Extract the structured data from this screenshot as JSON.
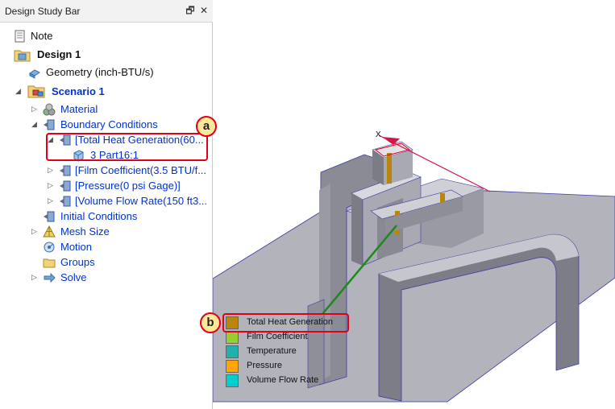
{
  "panel": {
    "title": "Design Study Bar",
    "restore_glyph": "🗗",
    "close_glyph": "✕"
  },
  "tree": {
    "note": "Note",
    "design": "Design 1",
    "geometry": "Geometry (inch-BTU/s)",
    "scenario": "Scenario 1",
    "material": "Material",
    "boundary_conditions": "Boundary Conditions",
    "total_heat_generation": "[Total Heat Generation(60...",
    "part": "3 Part16:1",
    "film_coefficient": "[Film Coefficient(3.5 BTU/f...",
    "pressure": "[Pressure(0 psi Gage)]",
    "volume_flow_rate": "[Volume Flow Rate(150 ft3...",
    "initial_conditions": "Initial Conditions",
    "mesh_size": "Mesh Size",
    "motion": "Motion",
    "groups": "Groups",
    "solve": "Solve"
  },
  "callouts": {
    "a": "a",
    "b": "b"
  },
  "viewport": {
    "axis_label": "X"
  },
  "legend": {
    "items": [
      {
        "label": "Total Heat Generation",
        "color": "#b8860b"
      },
      {
        "label": "Film Coefficient",
        "color": "#9acd32"
      },
      {
        "label": "Temperature",
        "color": "#20b2aa"
      },
      {
        "label": "Pressure",
        "color": "#ffa500"
      },
      {
        "label": "Volume Flow Rate",
        "color": "#00ced1"
      }
    ]
  },
  "colors": {
    "callout": "#e0001a",
    "tree_link": "#0033cc",
    "model_fill": "#a9a9b3"
  }
}
